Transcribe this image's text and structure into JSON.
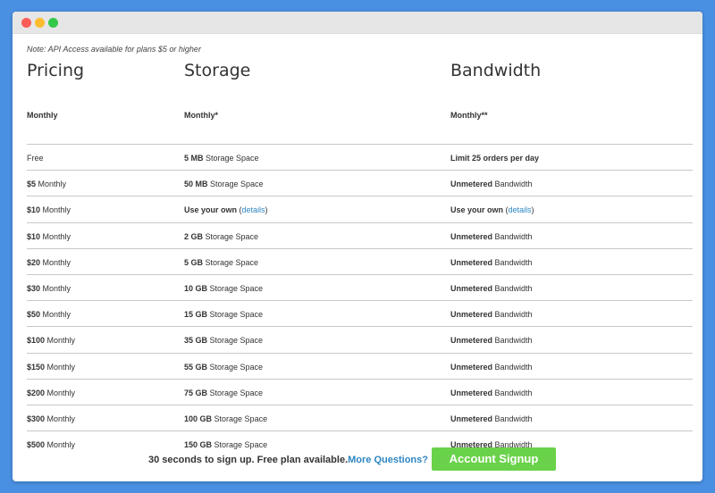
{
  "note": "Note: API Access available for plans $5 or higher",
  "headers": {
    "pricing": {
      "title": "Pricing",
      "sub": "Monthly"
    },
    "storage": {
      "title": "Storage",
      "sub": "Monthly*"
    },
    "bandwidth": {
      "title": "Bandwidth",
      "sub": "Monthly**"
    }
  },
  "rows": [
    {
      "price_bold": "",
      "price_rest": "Free",
      "storage_bold": "5 MB",
      "storage_rest": " Storage Space",
      "bandwidth_bold": "Limit 25 orders per day",
      "bandwidth_rest": ""
    },
    {
      "price_bold": "$5",
      "price_rest": " Monthly",
      "storage_bold": "50 MB",
      "storage_rest": " Storage Space",
      "bandwidth_bold": "Unmetered",
      "bandwidth_rest": " Bandwidth"
    },
    {
      "price_bold": "$10",
      "price_rest": " Monthly",
      "storage_bold": "Use your own",
      "storage_rest": "",
      "storage_link": "details",
      "bandwidth_bold": "Use your own",
      "bandwidth_rest": "",
      "bandwidth_link": "details"
    },
    {
      "price_bold": "$10",
      "price_rest": " Monthly",
      "storage_bold": "2 GB",
      "storage_rest": " Storage Space",
      "bandwidth_bold": "Unmetered",
      "bandwidth_rest": " Bandwidth"
    },
    {
      "price_bold": "$20",
      "price_rest": " Monthly",
      "storage_bold": "5 GB",
      "storage_rest": " Storage Space",
      "bandwidth_bold": "Unmetered",
      "bandwidth_rest": " Bandwidth"
    },
    {
      "price_bold": "$30",
      "price_rest": " Monthly",
      "storage_bold": "10 GB",
      "storage_rest": " Storage Space",
      "bandwidth_bold": "Unmetered",
      "bandwidth_rest": " Bandwidth"
    },
    {
      "price_bold": "$50",
      "price_rest": " Monthly",
      "storage_bold": "15 GB",
      "storage_rest": " Storage Space",
      "bandwidth_bold": "Unmetered",
      "bandwidth_rest": " Bandwidth"
    },
    {
      "price_bold": "$100",
      "price_rest": " Monthly",
      "storage_bold": "35 GB",
      "storage_rest": " Storage Space",
      "bandwidth_bold": "Unmetered",
      "bandwidth_rest": " Bandwidth"
    },
    {
      "price_bold": "$150",
      "price_rest": " Monthly",
      "storage_bold": "55 GB",
      "storage_rest": " Storage Space",
      "bandwidth_bold": "Unmetered",
      "bandwidth_rest": " Bandwidth"
    },
    {
      "price_bold": "$200",
      "price_rest": " Monthly",
      "storage_bold": "75 GB",
      "storage_rest": " Storage Space",
      "bandwidth_bold": "Unmetered",
      "bandwidth_rest": " Bandwidth"
    },
    {
      "price_bold": "$300",
      "price_rest": " Monthly",
      "storage_bold": "100 GB",
      "storage_rest": " Storage Space",
      "bandwidth_bold": "Unmetered",
      "bandwidth_rest": " Bandwidth"
    },
    {
      "price_bold": "$500",
      "price_rest": " Monthly",
      "storage_bold": "150 GB",
      "storage_rest": " Storage Space",
      "bandwidth_bold": "Unmetered",
      "bandwidth_rest": " Bandwidth"
    }
  ],
  "footer": {
    "text": "30 seconds to sign up. Free plan available.",
    "link": "More Questions?",
    "button": "Account Signup"
  },
  "colors": {
    "background": "#4a90e2",
    "link": "#2e86c1",
    "button": "#6ad24a"
  }
}
